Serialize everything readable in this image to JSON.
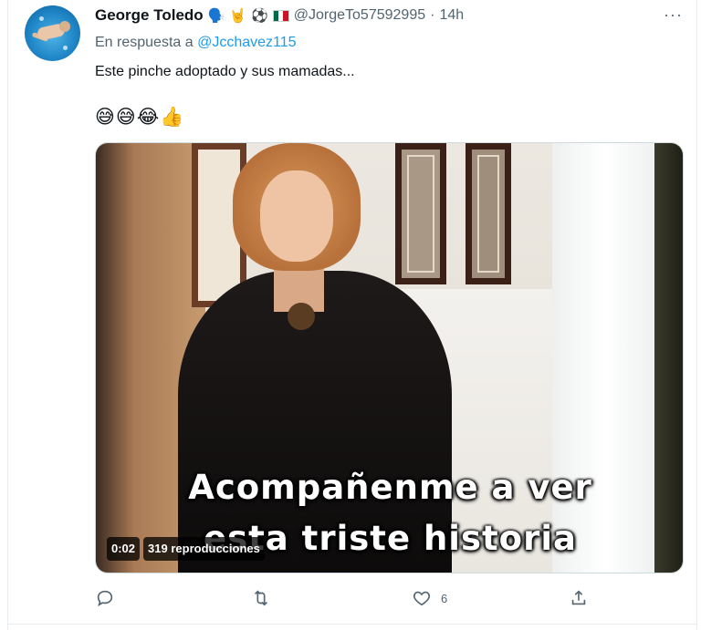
{
  "tweet": {
    "author_name": "George Toledo",
    "author_emojis": [
      "🗣️",
      "🤘",
      "⚽"
    ],
    "author_handle": "@JorgeTo57592995",
    "separator": "·",
    "time": "14h",
    "more_label": "···",
    "reply_prefix": "En respuesta a",
    "reply_mention": "@Jcchavez115",
    "text": "Este pinche adoptado y sus mamadas...",
    "emoji_line": "😅😅😂👍",
    "media": {
      "caption_line1": "Acompañenme a ver",
      "caption_line2": "esta triste historia",
      "duration": "0:02",
      "views": "319 reproducciones"
    },
    "actions": {
      "reply_icon": "reply-icon",
      "retweet_icon": "retweet-icon",
      "like_icon": "heart-icon",
      "like_count": "6",
      "share_icon": "share-icon"
    }
  },
  "colors": {
    "text_primary": "#0f1419",
    "text_secondary": "#536471",
    "link": "#1d9bf0",
    "border": "#e6ecf0"
  }
}
